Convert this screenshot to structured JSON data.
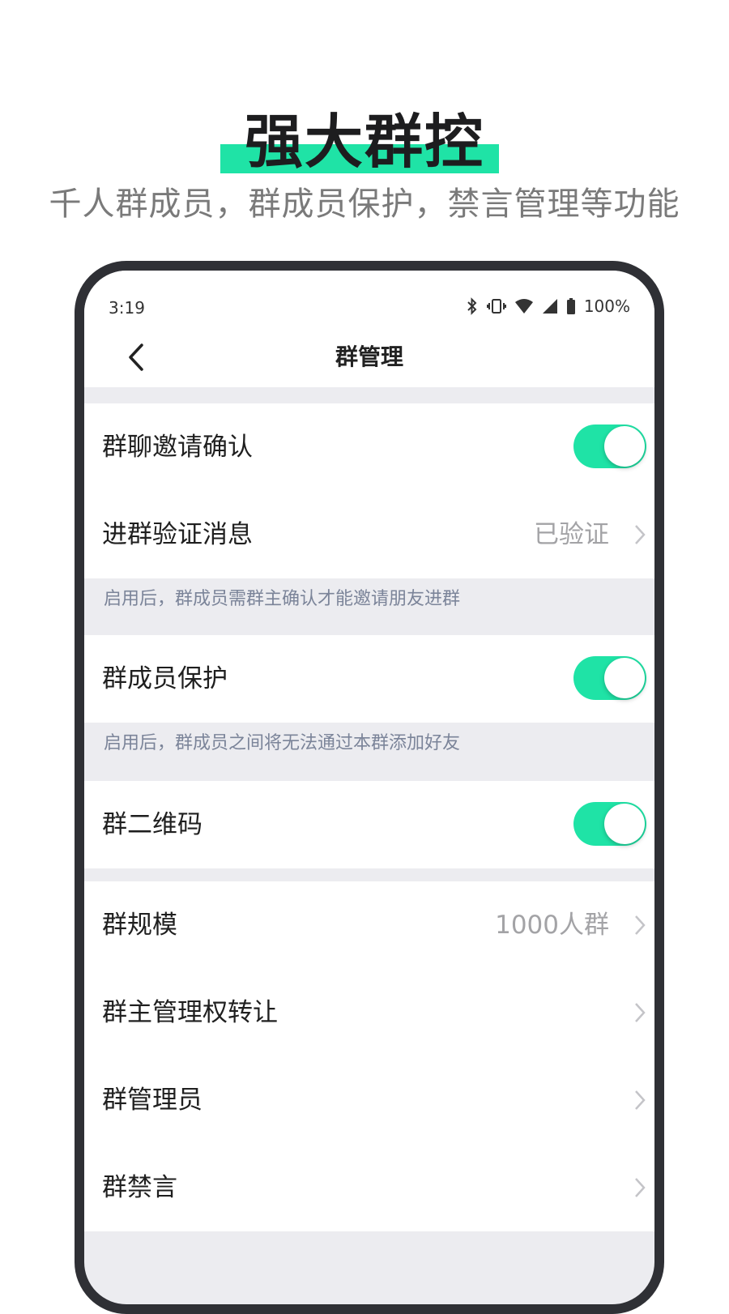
{
  "promo": {
    "title": "强大群控",
    "subtitle": "千人群成员，群成员保护，禁言管理等功能"
  },
  "status_bar": {
    "time": "3:19",
    "battery": "100%"
  },
  "nav": {
    "title": "群管理"
  },
  "settings": {
    "invite_confirm": {
      "label": "群聊邀请确认",
      "enabled": true
    },
    "join_verify": {
      "label": "进群验证消息",
      "value": "已验证"
    },
    "hint_invite": "启用后，群成员需群主确认才能邀请朋友进群",
    "member_protect": {
      "label": "群成员保护",
      "enabled": true
    },
    "hint_protect": "启用后，群成员之间将无法通过本群添加好友",
    "qr_code": {
      "label": "群二维码",
      "enabled": true
    },
    "group_size": {
      "label": "群规模",
      "value": "1000人群"
    },
    "transfer_owner": {
      "label": "群主管理权转让"
    },
    "admins": {
      "label": "群管理员"
    },
    "mute": {
      "label": "群禁言"
    }
  },
  "colors": {
    "accent": "#1fe3a6",
    "phone_frame": "#2f3035",
    "page_bg": "#ececf0"
  }
}
